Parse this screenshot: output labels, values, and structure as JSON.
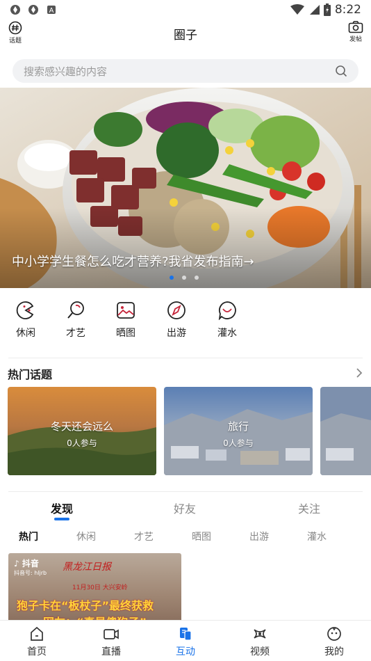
{
  "status_bar": {
    "time": "8:22"
  },
  "header": {
    "title": "圈子",
    "left_label": "话题",
    "right_label": "发帖"
  },
  "search": {
    "placeholder": "搜索感兴趣的内容"
  },
  "banner": {
    "caption": "中小学学生餐怎么吃才营养?我省发布指南→",
    "page_count": 3,
    "active_index": 0
  },
  "categories": [
    {
      "label": "休闲",
      "icon": "pacman-icon"
    },
    {
      "label": "才艺",
      "icon": "mirror-icon"
    },
    {
      "label": "晒图",
      "icon": "image-icon"
    },
    {
      "label": "出游",
      "icon": "compass-icon"
    },
    {
      "label": "灌水",
      "icon": "chat-smile-icon"
    }
  ],
  "hot_topics": {
    "title": "热门话题",
    "items": [
      {
        "title": "冬天还会远么",
        "count": "0人参与"
      },
      {
        "title": "旅行",
        "count": "0人参与"
      }
    ]
  },
  "tabs": [
    {
      "label": "发现",
      "active": true
    },
    {
      "label": "好友",
      "active": false
    },
    {
      "label": "关注",
      "active": false
    }
  ],
  "subtabs": [
    {
      "label": "热门",
      "active": true
    },
    {
      "label": "休闲",
      "active": false
    },
    {
      "label": "才艺",
      "active": false
    },
    {
      "label": "晒图",
      "active": false
    },
    {
      "label": "出游",
      "active": false
    },
    {
      "label": "灌水",
      "active": false
    }
  ],
  "feed_card": {
    "brand": "抖音",
    "account": "抖音号: hljrb",
    "paper": "黑龙江日报",
    "date": "11月30日 大兴安岭",
    "headline_1": "狍子卡在“板杖子”最终获救",
    "headline_2": "网友：“真是傻狍子”"
  },
  "bottom_nav": [
    {
      "label": "首页",
      "icon": "home-icon",
      "active": false
    },
    {
      "label": "直播",
      "icon": "live-icon",
      "active": false
    },
    {
      "label": "互动",
      "icon": "interact-icon",
      "active": true
    },
    {
      "label": "视频",
      "icon": "video-icon",
      "active": false
    },
    {
      "label": "我的",
      "icon": "profile-icon",
      "active": false
    }
  ],
  "colors": {
    "accent": "#1a73e8",
    "search_bg": "#f1f2f4",
    "category_icon": "#c5253a"
  }
}
